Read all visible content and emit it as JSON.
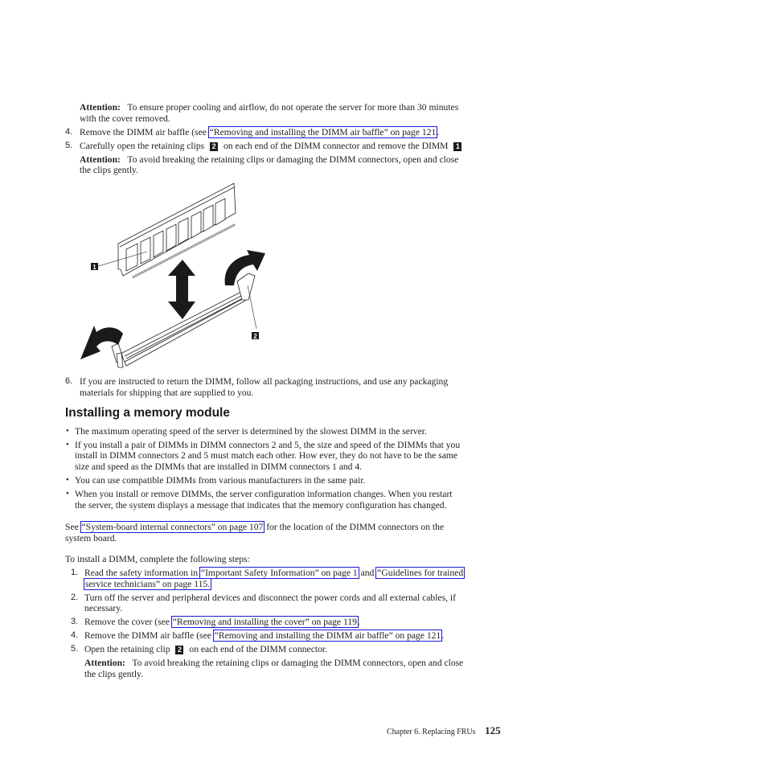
{
  "removal": {
    "attention1": {
      "label": "Attention:",
      "text": "To ensure proper cooling and airflow, do not operate the server for more than 30 minutes",
      "text2": "with the cover removed."
    },
    "step4": {
      "num": "4.",
      "pre": "Remove the DIMM air baffle (see ",
      "link": "“Removing and installing the DIMM air baffle” on page 121",
      "post": "."
    },
    "step5": {
      "num": "5.",
      "pre": "Carefully open the retaining clips",
      "callout_a": "2",
      "mid": "on each end of the DIMM connector and remove the DIMM",
      "callout_b": "1"
    },
    "attention2": {
      "label": "Attention:",
      "text": "To avoid breaking the retaining clips or damaging the DIMM connectors, open and close",
      "text2": "the clips gently."
    },
    "figure": {
      "callout_dimm": "1",
      "callout_clip": "2"
    },
    "step6": {
      "num": "6.",
      "line1": "If you are instructed to return the DIMM, follow all packaging instructions, and use any packaging",
      "line2": "materials for shipping that are supplied to you."
    }
  },
  "section": {
    "title": "Installing a memory module",
    "bullets": [
      {
        "lines": [
          "The maximum operating speed of the server is determined by the slowest DIMM in the server."
        ]
      },
      {
        "lines": [
          "If you install a pair of DIMMs in DIMM connectors 2 and 5, the size and speed of the DIMMs that you",
          "install in DIMM connectors 2 and 5 must match each other. How ever, they do not have to be the same",
          "size and speed as the DIMMs that are installed in DIMM connectors 1 and 4."
        ]
      },
      {
        "lines": [
          "You can use compatible DIMMs from various manufacturers in the same pair."
        ]
      },
      {
        "lines": [
          "When you install or remove DIMMs, the server configuration information changes. When you restart",
          "the server, the system displays a message that indicates that the memory configuration has changed."
        ]
      }
    ],
    "see": {
      "pre": "See ",
      "link": "“System-board internal connectors” on page 107",
      "post": " for the location of the DIMM connectors on the",
      "line2": "system board."
    },
    "intro": "To install a DIMM, complete the following steps:",
    "steps": {
      "s1": {
        "num": "1.",
        "pre": "Read the safety information in ",
        "link1": "“Important Safety Information” on page 1",
        "mid": " and ",
        "link2a": "“Guidelines for trained",
        "link2b": "service technicians” on page 115."
      },
      "s2": {
        "num": "2.",
        "line1": "Turn off the server and peripheral devices and disconnect the power cords and all external cables, if",
        "line2": "necessary."
      },
      "s3": {
        "num": "3.",
        "pre": "Remove the cover (see ",
        "link": "“Removing and installing the cover” on page 119",
        "post": "."
      },
      "s4": {
        "num": "4.",
        "pre": "Remove the DIMM air baffle (see ",
        "link": "“Removing and installing the DIMM air baffle” on page 121",
        "post": "."
      },
      "s5": {
        "num": "5.",
        "pre": "Open the retaining clip",
        "callout": "2",
        "post": "on each end of the DIMM connector."
      },
      "attention": {
        "label": "Attention:",
        "text": "To avoid breaking the retaining clips or damaging the DIMM connectors, open and close",
        "text2": "the clips gently."
      }
    }
  },
  "footer": {
    "chapter": "Chapter 6. Replacing FRUs",
    "page": "125"
  }
}
